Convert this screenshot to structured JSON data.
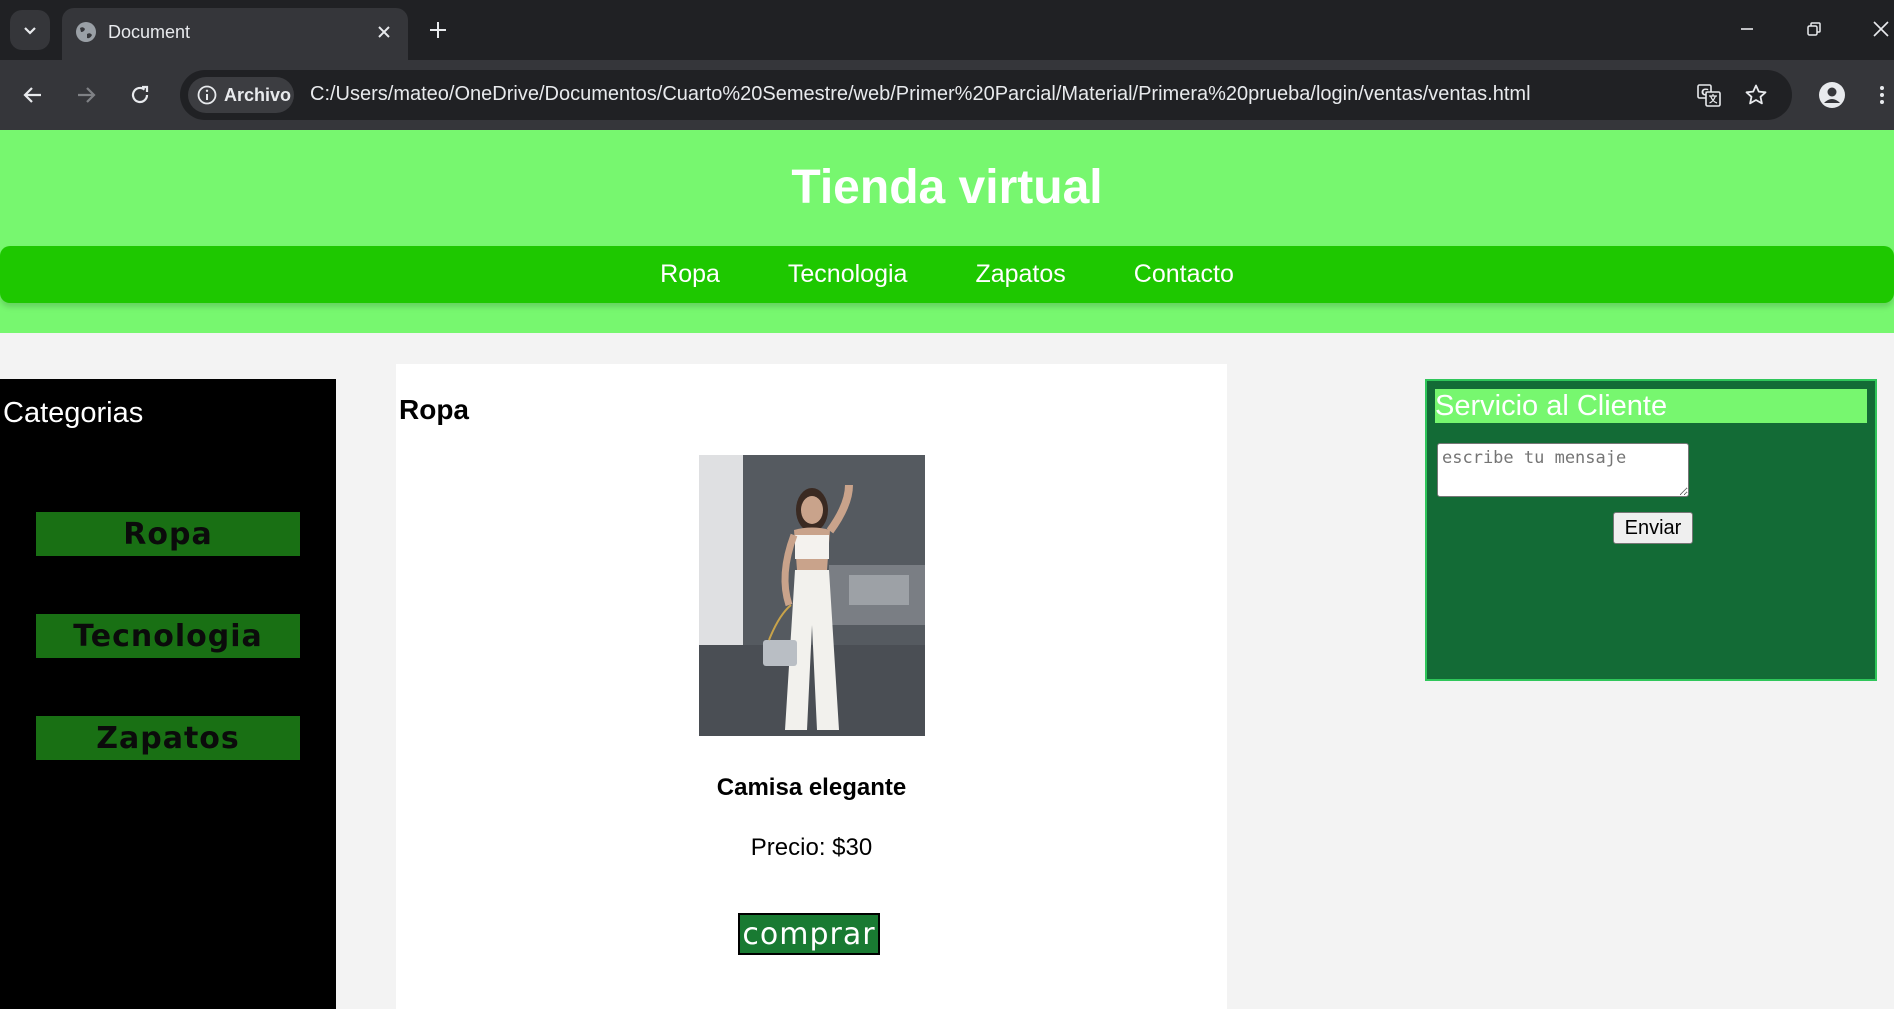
{
  "browser": {
    "tab_title": "Document",
    "site_chip_label": "Archivo",
    "url": "C:/Users/mateo/OneDrive/Documentos/Cuarto%20Semestre/web/Primer%20Parcial/Material/Primera%20prueba/login/ventas/ventas.html"
  },
  "header": {
    "title": "Tienda virtual",
    "nav": [
      "Ropa",
      "Tecnologia",
      "Zapatos",
      "Contacto"
    ]
  },
  "sidebar": {
    "title": "Categorias",
    "items": [
      "Ropa",
      "Tecnologia",
      "Zapatos"
    ]
  },
  "main": {
    "section_title": "Ropa",
    "product": {
      "name": "Camisa elegante",
      "price": "Precio: $30",
      "buy_label": "comprar"
    }
  },
  "support": {
    "title": "Servicio al Cliente",
    "placeholder": "escribe tu mensaje",
    "send_label": "Enviar"
  },
  "colors": {
    "header_bg": "#77f76f",
    "nav_bg": "#1ec800",
    "sidebar_bg": "#000000",
    "sidebar_button": "#197014",
    "buy_button": "#197a32",
    "support_bg": "#136b36"
  }
}
